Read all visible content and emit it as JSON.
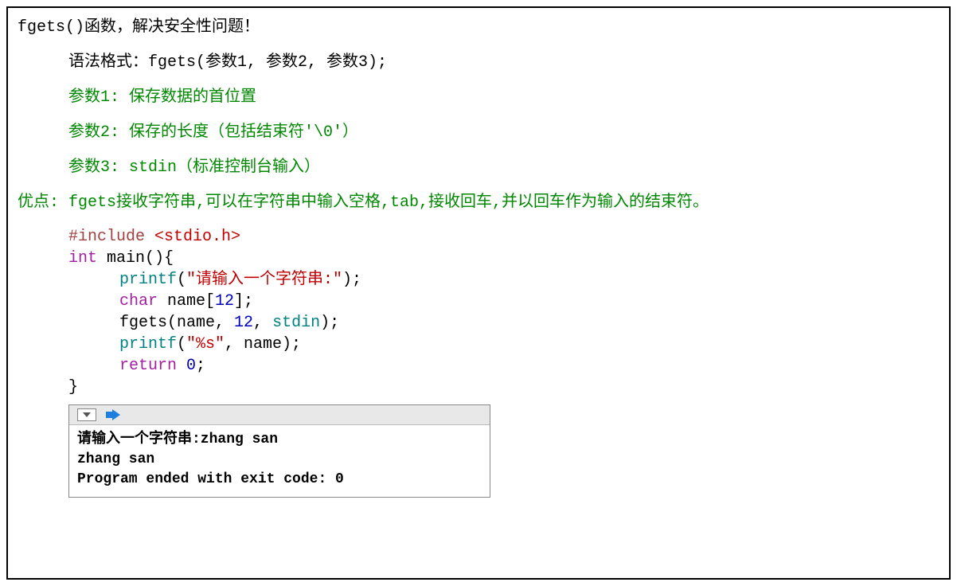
{
  "title_line": {
    "fn": "fgets()",
    "tail": "函数，解决安全性问题！"
  },
  "syntax": {
    "label": "语法格式：",
    "body": "fgets(参数1, 参数2, 参数3);"
  },
  "params": [
    "参数1: 保存数据的首位置",
    "参数2: 保存的长度（包括结束符'\\0'）",
    "参数3: stdin（标准控制台输入）"
  ],
  "advantage": {
    "label": "优点: ",
    "body": "fgets接收字符串,可以在字符串中输入空格,tab,接收回车,并以回车作为输入的结束符。"
  },
  "code": {
    "include_kw": "#include ",
    "include_val": "<stdio.h>",
    "int_kw": "int",
    "main_decl": " main(){",
    "printf1": {
      "name": "printf",
      "open": "(",
      "str": "\"请输入一个字符串:\"",
      "close": ");"
    },
    "char_kw": "char",
    "name_decl": " name[",
    "twelve_a": "12",
    "name_decl_close": "];",
    "fgets": {
      "name": "fgets",
      "open": "(name, ",
      "num": "12",
      "mid": ", ",
      "stdin": "stdin",
      "close": ");"
    },
    "printf2": {
      "name": "printf",
      "open": "(",
      "str": "\"%s\"",
      "close": ", name);"
    },
    "return_kw": "return",
    "zero": " 0",
    "semi": ";",
    "brace_close": "}"
  },
  "console": {
    "line1": "请输入一个字符串:zhang san",
    "line2": "zhang san",
    "line3": "Program ended with exit code: 0"
  }
}
